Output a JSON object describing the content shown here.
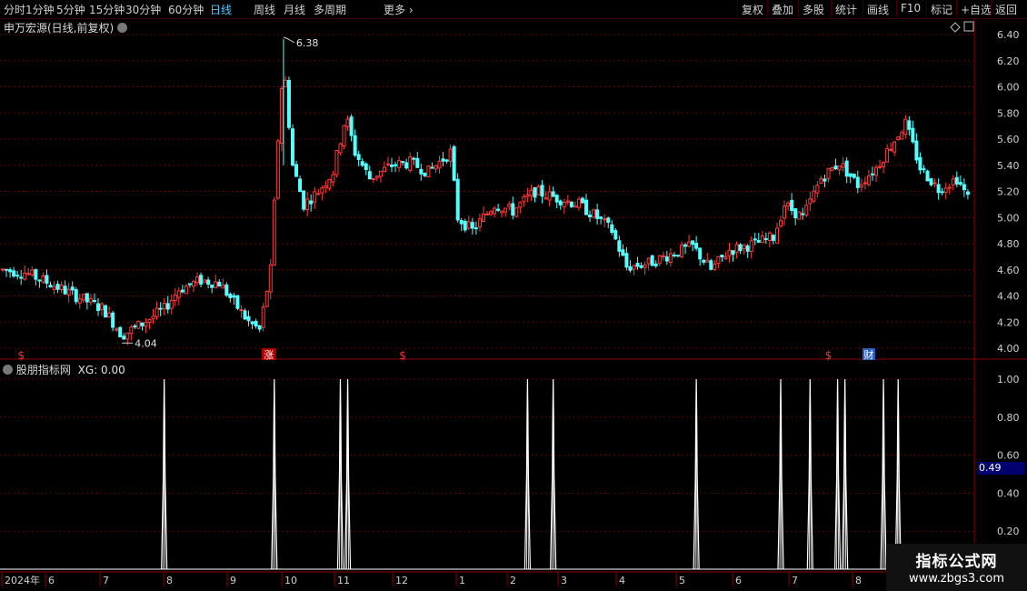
{
  "toolbar": {
    "periods": [
      "分时",
      "1分钟",
      "5分钟",
      "15分钟",
      "30分钟",
      "60分钟",
      "日线",
      "周线",
      "月线",
      "多周期"
    ],
    "active_period": "日线",
    "more": "更多",
    "right_buttons": [
      "复权",
      "叠加",
      "多股",
      "统计",
      "画线",
      "F10",
      "标记",
      "+自选",
      "返回"
    ]
  },
  "main_panel": {
    "title": "申万宏源(日线,前复权)",
    "high_marker": "6.38",
    "low_marker": "4.04",
    "event_badges": [
      {
        "label": "$",
        "kind": "s",
        "bar": 10
      },
      {
        "label": "涨",
        "kind": "zhang",
        "bar": 145
      },
      {
        "label": "$",
        "kind": "s",
        "bar": 218
      },
      {
        "label": "$",
        "kind": "s",
        "bar": 450
      },
      {
        "label": "财",
        "kind": "cai",
        "bar": 472
      }
    ]
  },
  "sub_panel": {
    "title": "股朋指标网",
    "xg_label": "XG: 0.00",
    "current_value": "0.49"
  },
  "watermark": {
    "title": "指标公式网",
    "url": "www.zbgs3.com"
  },
  "chart_data": {
    "type": "candlestick",
    "price_axis": {
      "ticks": [
        "6.40",
        "6.20",
        "6.00",
        "5.80",
        "5.60",
        "5.40",
        "5.20",
        "5.00",
        "4.80",
        "4.60",
        "4.40",
        "4.20",
        "4.00"
      ],
      "range": [
        3.96,
        6.46
      ]
    },
    "indicator_axis": {
      "ticks": [
        "1.00",
        "0.80",
        "0.60",
        "0.40",
        "0.20"
      ],
      "range": [
        0,
        1.04
      ]
    },
    "date_axis": [
      "2024年",
      "6",
      "7",
      "8",
      "9",
      "10",
      "11",
      "12",
      "1",
      "2",
      "3",
      "4",
      "5",
      "6",
      "7",
      "8"
    ],
    "price_path": [
      [
        0,
        4.6
      ],
      [
        12,
        4.58
      ],
      [
        25,
        4.5
      ],
      [
        40,
        4.4
      ],
      [
        55,
        4.3
      ],
      [
        65,
        4.1
      ],
      [
        75,
        4.18
      ],
      [
        88,
        4.3
      ],
      [
        96,
        4.45
      ],
      [
        108,
        4.52
      ],
      [
        118,
        4.5
      ],
      [
        126,
        4.35
      ],
      [
        134,
        4.2
      ],
      [
        140,
        4.14
      ],
      [
        146,
        4.6
      ],
      [
        150,
        5.6
      ],
      [
        153,
        6.2
      ],
      [
        158,
        5.4
      ],
      [
        164,
        5.1
      ],
      [
        172,
        5.2
      ],
      [
        180,
        5.35
      ],
      [
        187,
        5.78
      ],
      [
        192,
        5.5
      ],
      [
        200,
        5.3
      ],
      [
        212,
        5.4
      ],
      [
        222,
        5.42
      ],
      [
        232,
        5.35
      ],
      [
        244,
        5.5
      ],
      [
        248,
        5.0
      ],
      [
        256,
        4.9
      ],
      [
        268,
        5.1
      ],
      [
        278,
        5.05
      ],
      [
        290,
        5.2
      ],
      [
        302,
        5.15
      ],
      [
        314,
        5.1
      ],
      [
        324,
        5.0
      ],
      [
        332,
        4.9
      ],
      [
        340,
        4.62
      ],
      [
        352,
        4.65
      ],
      [
        364,
        4.72
      ],
      [
        376,
        4.78
      ],
      [
        386,
        4.6
      ],
      [
        396,
        4.75
      ],
      [
        410,
        4.8
      ],
      [
        420,
        4.85
      ],
      [
        426,
        5.1
      ],
      [
        436,
        5.0
      ],
      [
        446,
        5.3
      ],
      [
        456,
        5.42
      ],
      [
        466,
        5.25
      ],
      [
        476,
        5.38
      ],
      [
        484,
        5.55
      ],
      [
        492,
        5.72
      ],
      [
        500,
        5.38
      ],
      [
        510,
        5.22
      ],
      [
        520,
        5.3
      ],
      [
        526,
        5.15
      ]
    ],
    "signal_bars": [
      88,
      148,
      184,
      188,
      286,
      300,
      378,
      424,
      440,
      455,
      459,
      480,
      488
    ]
  }
}
